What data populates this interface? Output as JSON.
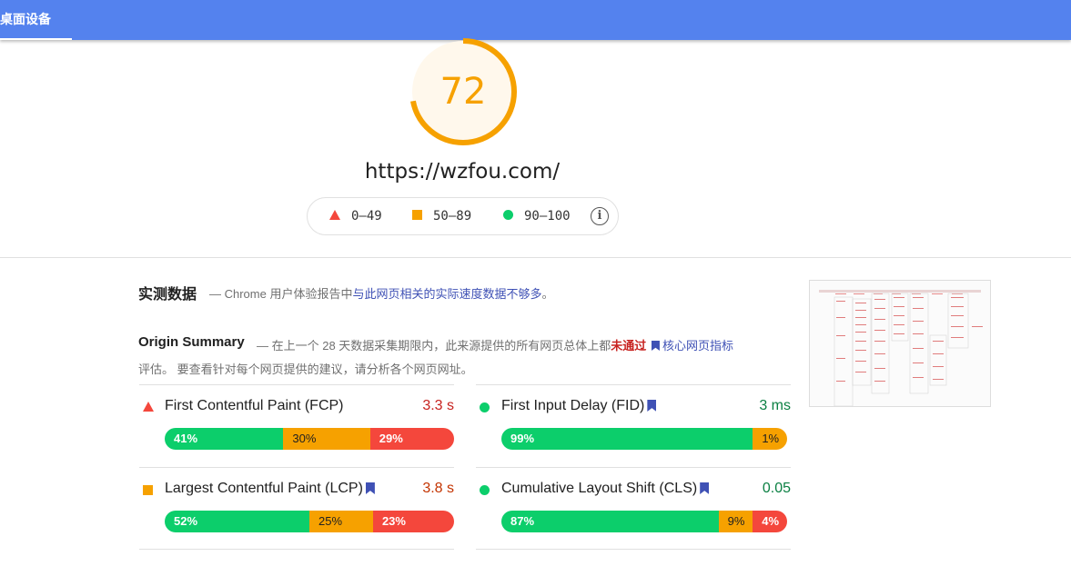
{
  "header": {
    "tab_label": "桌面设备"
  },
  "score": {
    "value": "72",
    "fraction": 0.72,
    "color": "#f6a100"
  },
  "url": "https://wzfou.com/",
  "legend": {
    "poor": "0–49",
    "average": "50–89",
    "good": "90–100"
  },
  "field_data": {
    "title": "实测数据",
    "desc_prefix": "— Chrome 用户体验报告中",
    "desc_link": "与此网页相关的实际速度数据不够多",
    "desc_suffix": "。"
  },
  "origin_summary": {
    "title": "Origin Summary",
    "desc_1": "— 在上一个 28 天数据采集期限内，此来源提供的所有网页总体上都",
    "fail_text": "未通过",
    "link_1": "核心网",
    "link_2": "页指标",
    "desc_2": "评估。 要查看针对每个网页提供的建议，请分析各个网页网址。"
  },
  "metrics": [
    {
      "name": "First Contentful Paint (FCP)",
      "value": "3.3 s",
      "value_color": "#c7221f",
      "status": "poor",
      "bookmark": false,
      "good": "41%",
      "average": "30%",
      "poor": "29%",
      "good_pct": 41,
      "average_pct": 30,
      "poor_pct": 29
    },
    {
      "name": "First Input Delay (FID)",
      "value": "3 ms",
      "value_color": "#0b8043",
      "status": "good",
      "bookmark": true,
      "good": "99%",
      "average": "1%",
      "poor": "",
      "good_pct": 88,
      "average_pct": 12,
      "poor_pct": 0
    },
    {
      "name": "Largest Contentful Paint (LCP)",
      "value": "3.8 s",
      "value_color": "#c33300",
      "status": "average",
      "bookmark": true,
      "good": "52%",
      "average": "25%",
      "poor": "23%",
      "good_pct": 50,
      "average_pct": 22,
      "poor_pct": 28
    },
    {
      "name": "Cumulative Layout Shift (CLS)",
      "value": "0.05",
      "value_color": "#0b8043",
      "status": "good",
      "bookmark": true,
      "good": "87%",
      "average": "9%",
      "poor": "4%",
      "good_pct": 76,
      "average_pct": 12,
      "poor_pct": 12
    }
  ]
}
